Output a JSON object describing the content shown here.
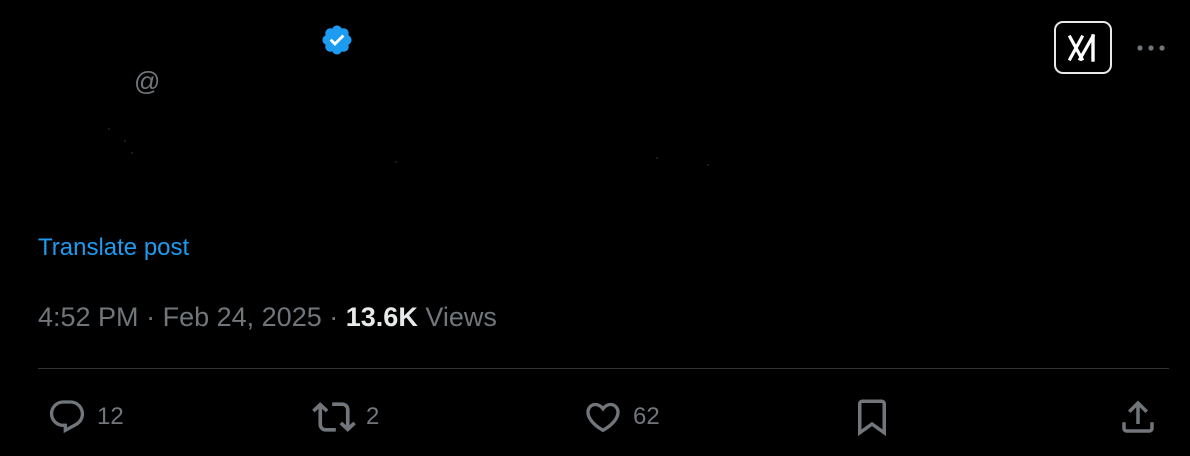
{
  "tweet": {
    "author": {
      "name": "",
      "handle_prefix": "@",
      "verified": true,
      "badge_color": "#1d9bf0"
    },
    "header_actions": {
      "grok_icon": "grok-logo-icon",
      "more_icon": "more-horizontal-icon"
    },
    "body_text": "",
    "translate_label": "Translate post",
    "time": "4:52 PM",
    "separator": "·",
    "date": "Feb 24, 2025",
    "views_count": "13.6K",
    "views_label": "Views",
    "actions": {
      "reply_count": "12",
      "retweet_count": "2",
      "like_count": "62"
    }
  },
  "theme": {
    "background": "#000000",
    "text_primary": "#e7e9ea",
    "text_secondary": "#71767b",
    "link": "#1d9bf0",
    "divider": "#2f3336"
  }
}
